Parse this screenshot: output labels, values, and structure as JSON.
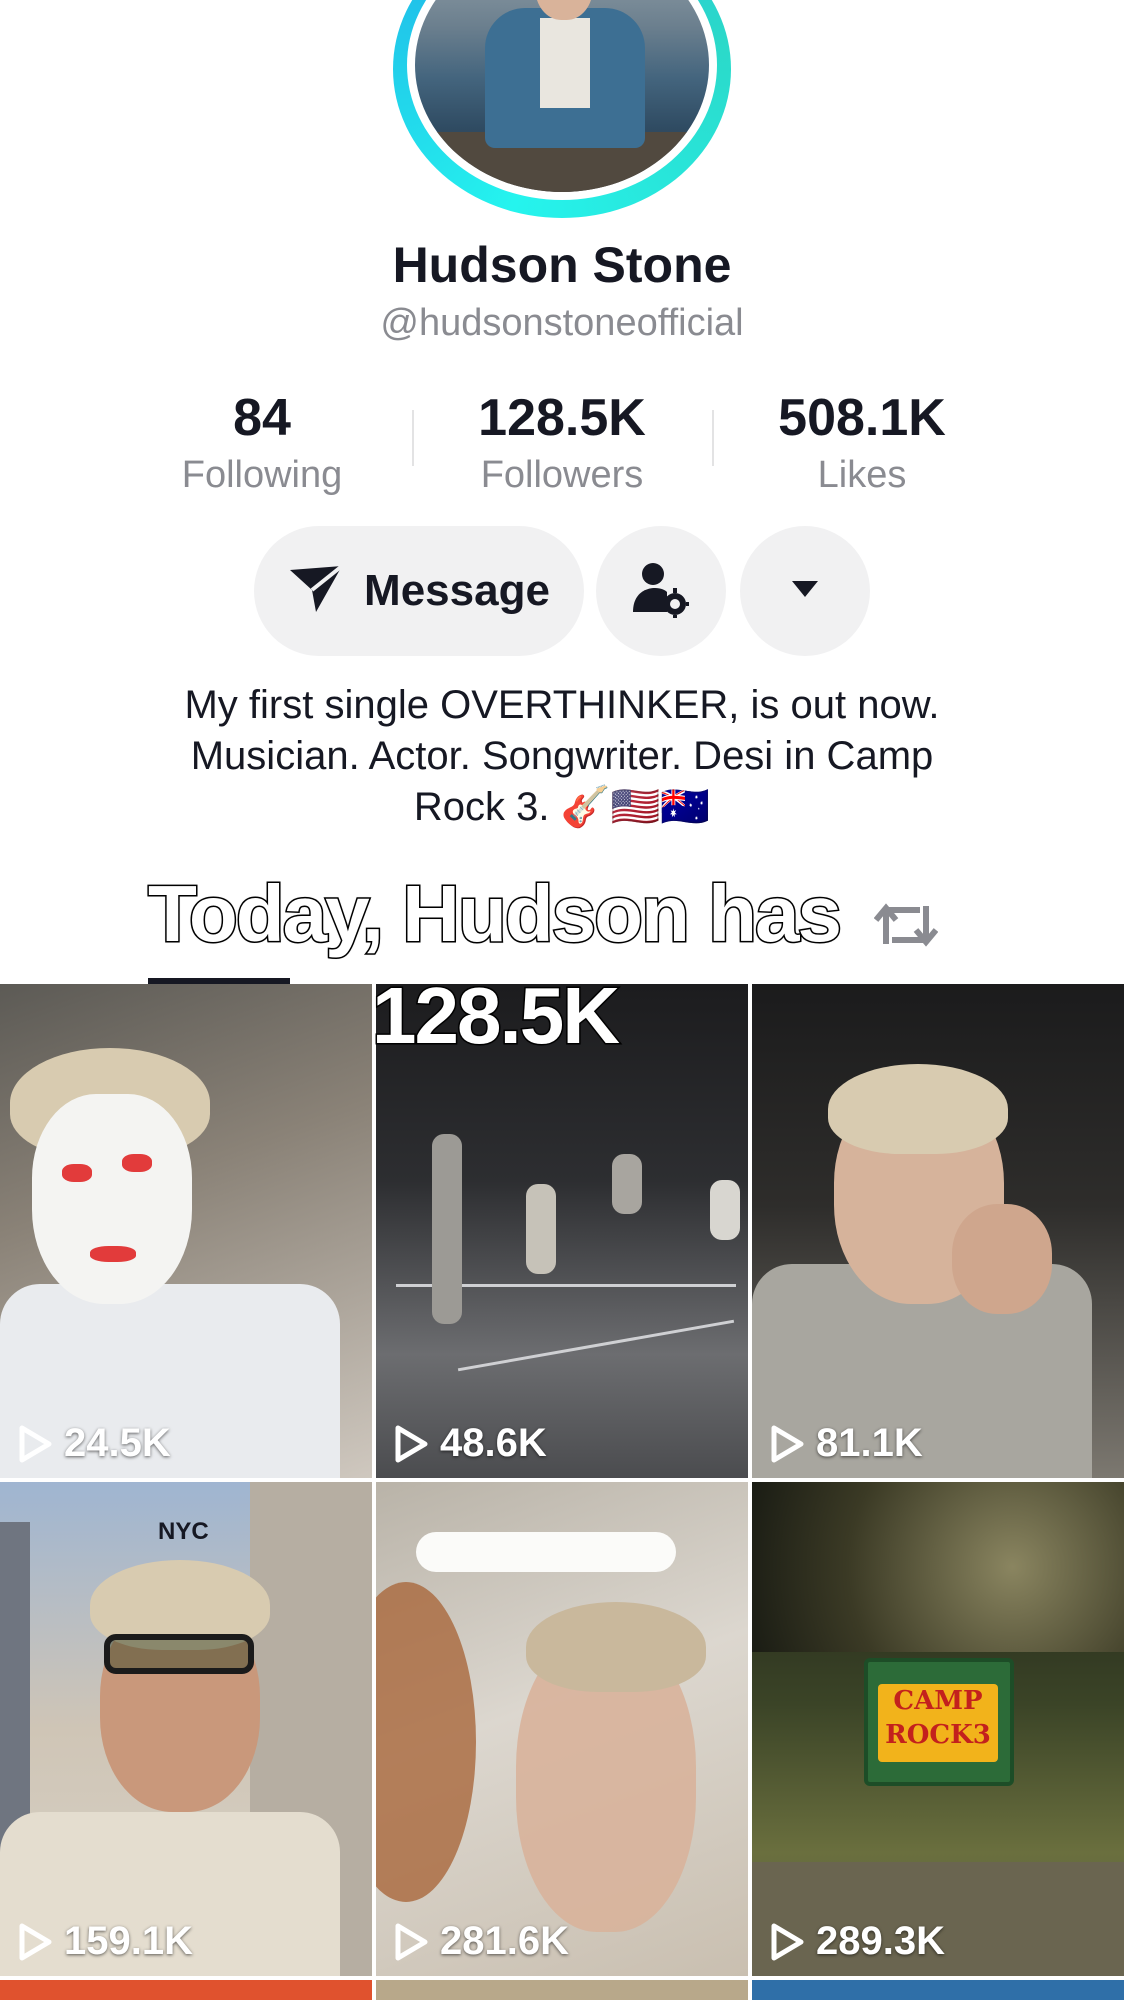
{
  "profile": {
    "name": "Hudson Stone",
    "handle": "@hudsonstoneofficial"
  },
  "stats": [
    {
      "value": "84",
      "label": "Following"
    },
    {
      "value": "128.5K",
      "label": "Followers"
    },
    {
      "value": "508.1K",
      "label": "Likes"
    }
  ],
  "actions": {
    "message_label": "Message",
    "message_icon": "send-icon",
    "person_icon": "person-settings-icon",
    "dropdown_icon": "caret-down-icon"
  },
  "bio": {
    "line1": "My first single OVERTHINKER, is out now.",
    "line2": "Musician. Actor. Songwriter. Desi in Camp",
    "line3": "Rock 3. 🎸🇺🇸🇦🇺"
  },
  "overlay": {
    "line1": "Today, Hudson has",
    "line2": "128.5K"
  },
  "videos": [
    {
      "views": "24.5K"
    },
    {
      "views": "48.6K"
    },
    {
      "views": "81.1K"
    },
    {
      "views": "159.1K",
      "caption": "NYC"
    },
    {
      "views": "281.6K"
    },
    {
      "views": "289.3K",
      "sign": "CAMP ROCK3"
    }
  ],
  "colors": {
    "ring_start": "#25f4ee",
    "ring_end": "#1fb6e8",
    "text_primary": "#161823",
    "text_secondary": "#8a8b91",
    "button_bg": "#f1f1f2"
  }
}
